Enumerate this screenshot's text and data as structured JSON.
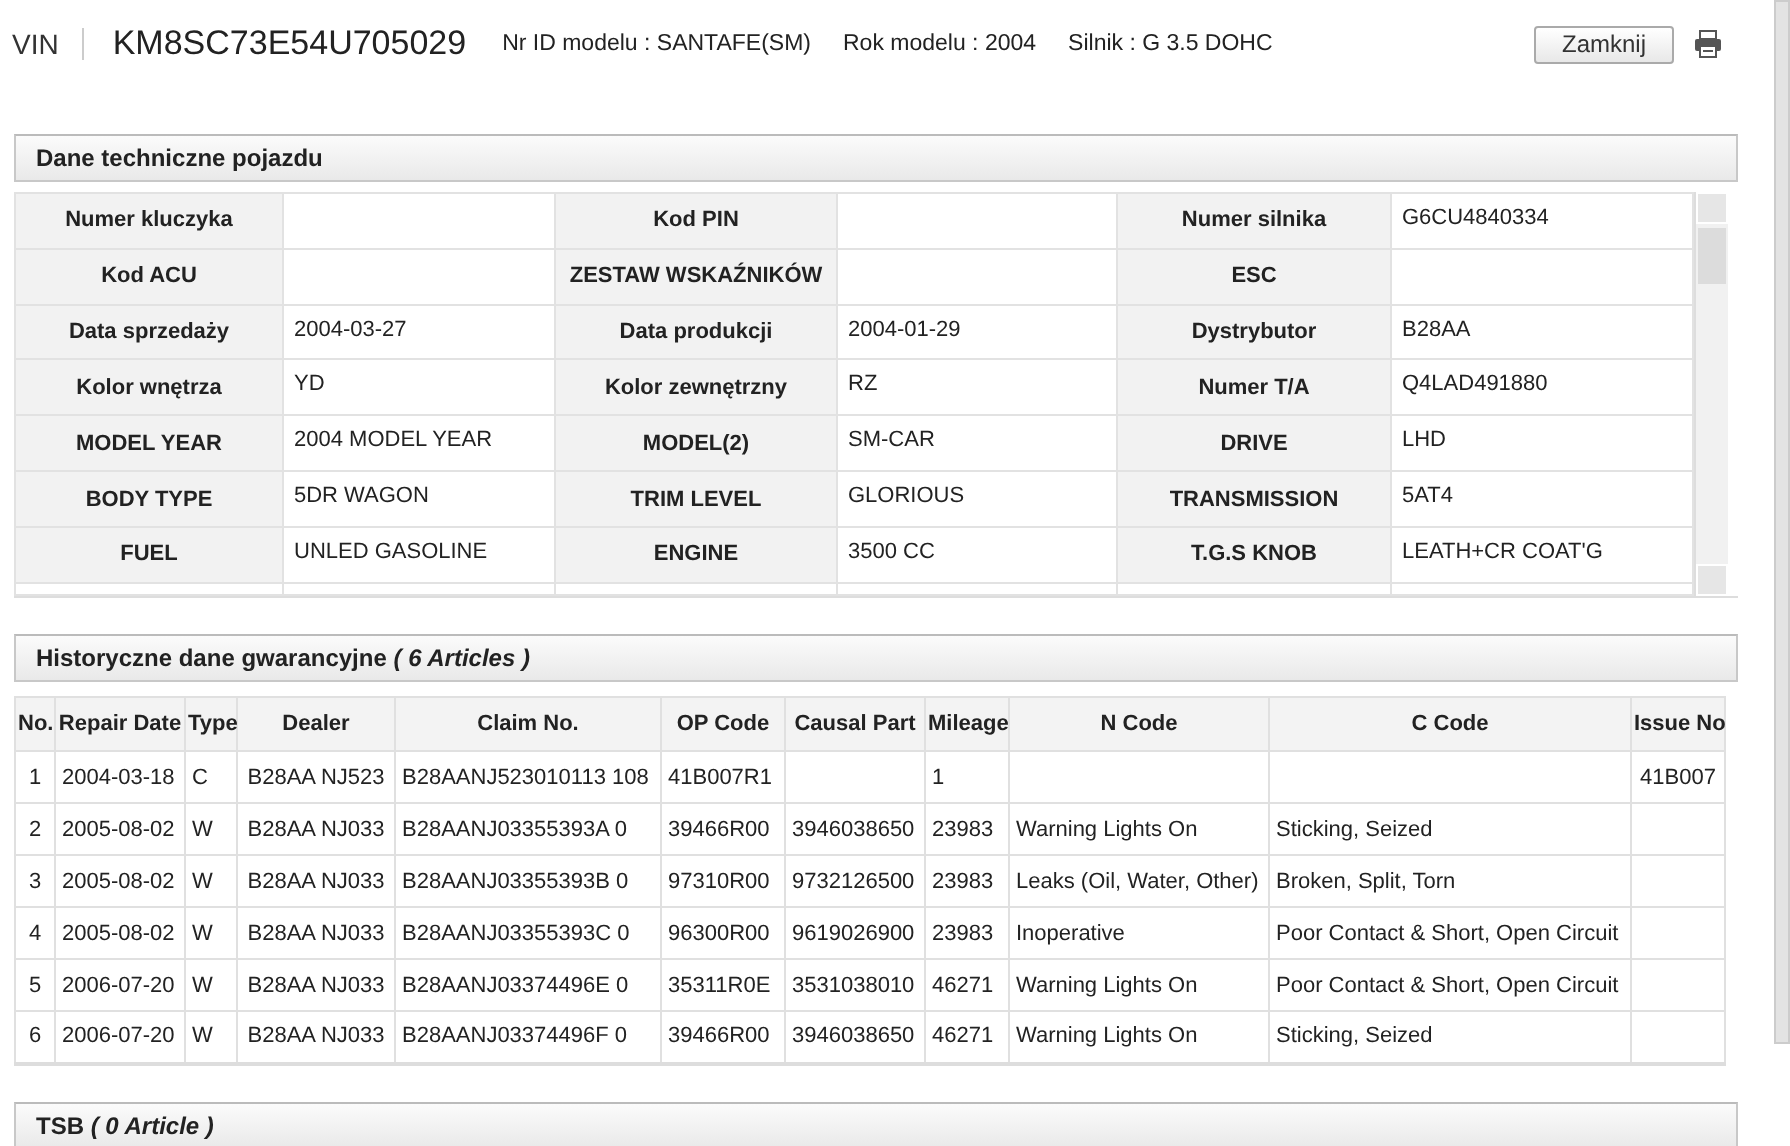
{
  "header": {
    "vin_label": "VIN",
    "vin": "KM8SC73E54U705029",
    "info": [
      "Nr ID modelu : SANTAFE(SM)",
      "Rok modelu : 2004",
      "Silnik : G 3.5 DOHC"
    ],
    "close_button": "Zamknij"
  },
  "tech_section": {
    "title": "Dane techniczne pojazdu",
    "rows": [
      [
        {
          "label": "Numer kluczyka"
        },
        {
          "label": "Kod PIN"
        },
        {
          "label": "Numer silnika",
          "value": "G6CU4840334"
        }
      ],
      [
        {
          "label": "Kod ACU"
        },
        {
          "label": "ZESTAW WSKAŹNIKÓW"
        },
        {
          "label": "ESC"
        }
      ],
      [
        {
          "label": "Data sprzedaży",
          "value": "2004-03-27"
        },
        {
          "label": "Data produkcji",
          "value": "2004-01-29"
        },
        {
          "label": "Dystrybutor",
          "value": "B28AA"
        }
      ],
      [
        {
          "label": "Kolor wnętrza",
          "value": "YD"
        },
        {
          "label": "Kolor zewnętrzny",
          "value": "RZ"
        },
        {
          "label": "Numer T/A",
          "value": "Q4LAD491880"
        }
      ],
      [
        {
          "label": "MODEL YEAR",
          "value": "2004 MODEL YEAR"
        },
        {
          "label": "MODEL(2)",
          "value": "SM-CAR"
        },
        {
          "label": "DRIVE",
          "value": "LHD"
        }
      ],
      [
        {
          "label": "BODY TYPE",
          "value": "5DR WAGON"
        },
        {
          "label": "TRIM LEVEL",
          "value": "GLORIOUS"
        },
        {
          "label": "TRANSMISSION",
          "value": "5AT4"
        }
      ],
      [
        {
          "label": "FUEL",
          "value": "UNLED GASOLINE"
        },
        {
          "label": "ENGINE",
          "value": "3500 CC"
        },
        {
          "label": "T.G.S KNOB",
          "value": "LEATH+CR COAT'G"
        }
      ]
    ]
  },
  "warranty_section": {
    "title": "Historyczne dane gwarancyjne *( 6 Articles )*",
    "columns": [
      "No.",
      "Repair Date",
      "Type",
      "Dealer",
      "Claim No.",
      "OP Code",
      "Causal Part",
      "Mileage",
      "N Code",
      "C Code",
      "Issue No"
    ],
    "rows": [
      [
        "1",
        "2004-03-18",
        "C",
        "B28AA NJ523",
        "B28AANJ523010113 108",
        "41B007R1",
        "",
        "1",
        "",
        "",
        "41B007"
      ],
      [
        "2",
        "2005-08-02",
        "W",
        "B28AA NJ033",
        "B28AANJ03355393A 0",
        "39466R00",
        "3946038650",
        "23983",
        "Warning Lights On",
        "Sticking, Seized",
        ""
      ],
      [
        "3",
        "2005-08-02",
        "W",
        "B28AA NJ033",
        "B28AANJ03355393B 0",
        "97310R00",
        "9732126500",
        "23983",
        "Leaks (Oil, Water, Other)",
        "Broken, Split, Torn",
        ""
      ],
      [
        "4",
        "2005-08-02",
        "W",
        "B28AA NJ033",
        "B28AANJ03355393C 0",
        "96300R00",
        "9619026900",
        "23983",
        "Inoperative",
        "Poor Contact & Short, Open Circuit",
        ""
      ],
      [
        "5",
        "2006-07-20",
        "W",
        "B28AA NJ033",
        "B28AANJ03374496E 0",
        "35311R0E",
        "3531038010",
        "46271",
        "Warning Lights On",
        "Poor Contact & Short, Open Circuit",
        ""
      ],
      [
        "6",
        "2006-07-20",
        "W",
        "B28AA NJ033",
        "B28AANJ03374496F 0",
        "39466R00",
        "3946038650",
        "46271",
        "Warning Lights On",
        "Sticking, Seized",
        ""
      ]
    ]
  },
  "tsb_section": {
    "title": "TSB *( 0 Article )*"
  }
}
